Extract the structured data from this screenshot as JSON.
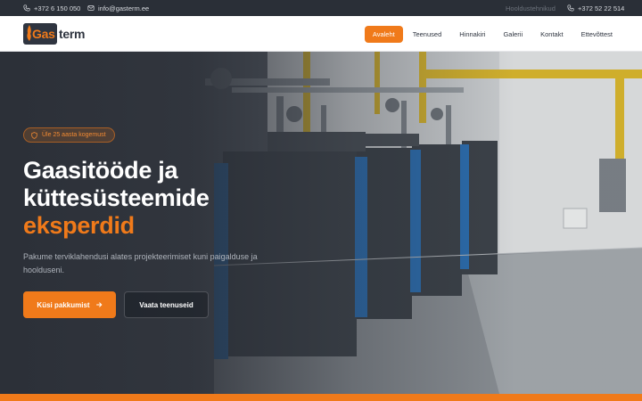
{
  "topbar": {
    "phone": "+372 6 150 050",
    "email": "info@gasterm.ee",
    "maintenance": "Hooldustehnikud",
    "maintenance_phone": "+372 52 22 514"
  },
  "logo": {
    "gas": "Gas",
    "term": "term"
  },
  "nav": {
    "items": [
      {
        "label": "Avaleht",
        "active": true
      },
      {
        "label": "Teenused"
      },
      {
        "label": "Hinnakiri"
      },
      {
        "label": "Galerii"
      },
      {
        "label": "Kontakt"
      },
      {
        "label": "Ettevõttest"
      }
    ]
  },
  "hero": {
    "badge": "Üle 25 aasta kogemust",
    "title_line1": "Gaasitööde ja",
    "title_line2": "küttesüsteemide",
    "title_accent": "eksperdid",
    "lead": "Pakume terviklahendusi alates projekteerimiset kuni paigalduse ja hoolduseni.",
    "cta_primary": "Küsi pakkumist",
    "cta_secondary": "Vaata teenuseid"
  },
  "colors": {
    "accent": "#f07a1a",
    "dark": "#2a2f37"
  },
  "icons": {
    "phone": "phone-icon",
    "email": "envelope-icon",
    "badge": "shield-icon",
    "cta": "arrow-right-icon"
  }
}
